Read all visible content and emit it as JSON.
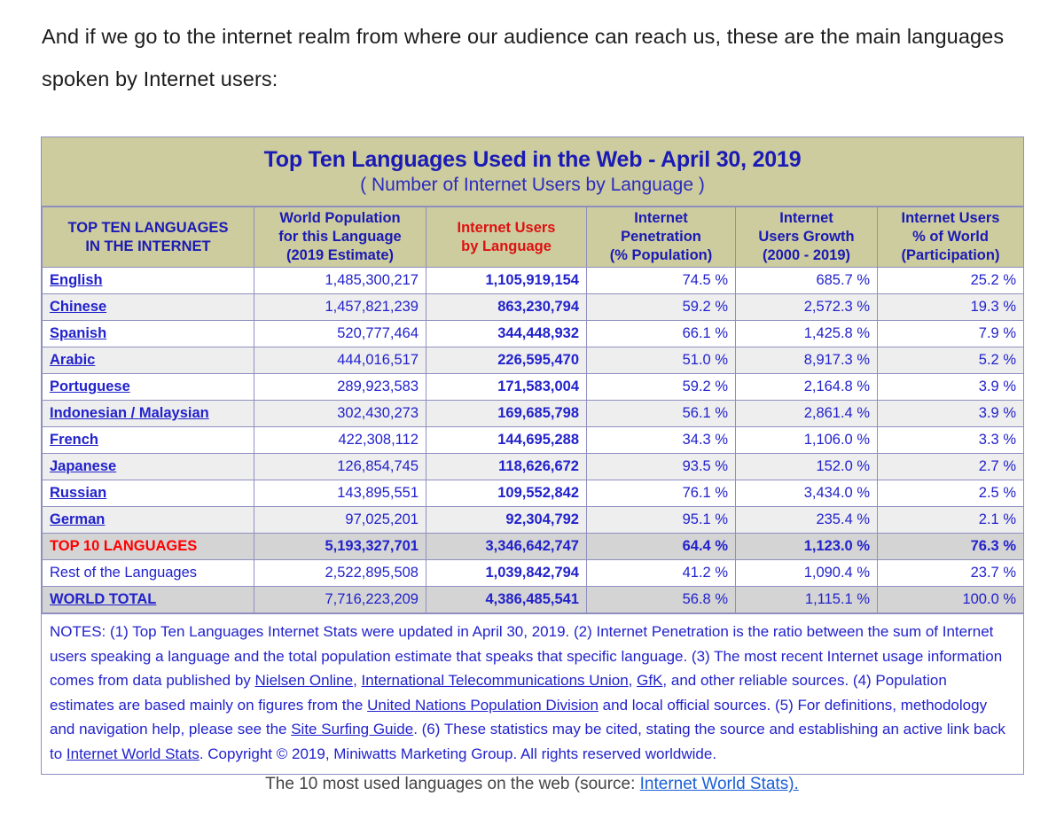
{
  "intro": {
    "text": "And if we go to the internet realm from where our audience can reach us, these are the main languages spoken by Internet users:"
  },
  "table": {
    "title_main": "Top Ten Languages Used in the Web - April 30, 2019",
    "title_sub": "( Number of Internet Users by Language )",
    "headers": [
      "TOP TEN LANGUAGES\nIN THE INTERNET",
      "World Population\nfor this Language\n(2019 Estimate)",
      "Internet Users\nby Language",
      "Internet\nPenetration\n(% Population)",
      "Internet\nUsers Growth\n(2000 - 2019)",
      "Internet Users\n% of World\n(Participation)"
    ],
    "headers_flat": {
      "c0_l1": "TOP TEN LANGUAGES",
      "c0_l2": "IN THE INTERNET",
      "c1_l1": "World Population",
      "c1_l2": "for this Language",
      "c1_l3": "(2019 Estimate)",
      "c2_l1": "Internet Users",
      "c2_l2": "by Language",
      "c3_l1": "Internet",
      "c3_l2": "Penetration",
      "c3_l3": "(% Population)",
      "c4_l1": "Internet",
      "c4_l2": "Users Growth",
      "c4_l3": "(2000 - 2019)",
      "c5_l1": "Internet Users",
      "c5_l2": "% of World",
      "c5_l3": "(Participation)"
    },
    "rows": [
      {
        "language": "English",
        "population": "1,485,300,217",
        "users": "1,105,919,154",
        "penetration": "74.5 %",
        "growth": "685.7 %",
        "share": "25.2 %"
      },
      {
        "language": "Chinese",
        "population": "1,457,821,239",
        "users": "863,230,794",
        "penetration": "59.2 %",
        "growth": "2,572.3 %",
        "share": "19.3 %"
      },
      {
        "language": "Spanish",
        "population": "520,777,464",
        "users": "344,448,932",
        "penetration": "66.1 %",
        "growth": "1,425.8 %",
        "share": "7.9 %"
      },
      {
        "language": "Arabic",
        "population": "444,016,517",
        "users": "226,595,470",
        "penetration": "51.0 %",
        "growth": "8,917.3 %",
        "share": "5.2 %"
      },
      {
        "language": "Portuguese",
        "population": "289,923,583",
        "users": "171,583,004",
        "penetration": "59.2 %",
        "growth": "2,164.8 %",
        "share": "3.9 %"
      },
      {
        "language": "Indonesian / Malaysian",
        "population": "302,430,273",
        "users": "169,685,798",
        "penetration": "56.1 %",
        "growth": "2,861.4 %",
        "share": "3.9 %"
      },
      {
        "language": "French",
        "population": "422,308,112",
        "users": "144,695,288",
        "penetration": "34.3 %",
        "growth": "1,106.0 %",
        "share": "3.3 %"
      },
      {
        "language": "Japanese",
        "population": "126,854,745",
        "users": "118,626,672",
        "penetration": "93.5 %",
        "growth": "152.0 %",
        "share": "2.7 %"
      },
      {
        "language": "Russian",
        "population": "143,895,551",
        "users": "109,552,842",
        "penetration": "76.1 %",
        "growth": "3,434.0 %",
        "share": "2.5 %"
      },
      {
        "language": "German",
        "population": "97,025,201",
        "users": "92,304,792",
        "penetration": "95.1 %",
        "growth": "235.4 %",
        "share": "2.1 %"
      }
    ],
    "summary_rows": [
      {
        "language": "TOP 10 LANGUAGES",
        "population": "5,193,327,701",
        "users": "3,346,642,747",
        "penetration": "64.4 %",
        "growth": "1,123.0 %",
        "share": "76.3 %"
      },
      {
        "language": "Rest of the Languages",
        "population": "2,522,895,508",
        "users": "1,039,842,794",
        "penetration": "41.2 %",
        "growth": "1,090.4 %",
        "share": "23.7 %"
      },
      {
        "language": "WORLD TOTAL",
        "population": "7,716,223,209",
        "users": "4,386,485,541",
        "penetration": "56.8 %",
        "growth": "1,115.1 %",
        "share": "100.0 %"
      }
    ],
    "notes": {
      "p1": "NOTES: (1) Top Ten Languages Internet Stats were updated in April 30, 2019. (2) Internet Penetration is the ratio between the sum of Internet users speaking a language and the total population estimate that speaks that specific language. (3) The most recent Internet usage information comes from data published by ",
      "link1": "Nielsen Online",
      "p2": ", ",
      "link2": "International Telecommunications Union",
      "p3": ", ",
      "link3": "GfK",
      "p4": ", and other reliable sources. (4) Population estimates are based mainly on figures from the ",
      "link4": "United Nations Population Division",
      "p5": " and local official sources. (5) For definitions, methodology and navigation help, please see the ",
      "link5": "Site Surfing Guide",
      "p6": ". (6) These statistics may be cited, stating the source and establishing an active link back to ",
      "link6": "Internet World Stats",
      "p7": ". Copyright © 2019, Miniwatts Marketing Group. All rights reserved worldwide."
    }
  },
  "caption": {
    "prefix": "The 10 most used languages on the web (source: ",
    "link": "Internet World Stats)."
  },
  "colors": {
    "header_bg": "#cdcc9e",
    "header_text": "#1a1ab4",
    "accent_red": "#dd1111",
    "data_text": "#2222cc",
    "border": "#8f8fbf",
    "alt_row": "#eeeeee",
    "total_row": "#d4d4d4",
    "caption_link": "#1a5fd6"
  }
}
